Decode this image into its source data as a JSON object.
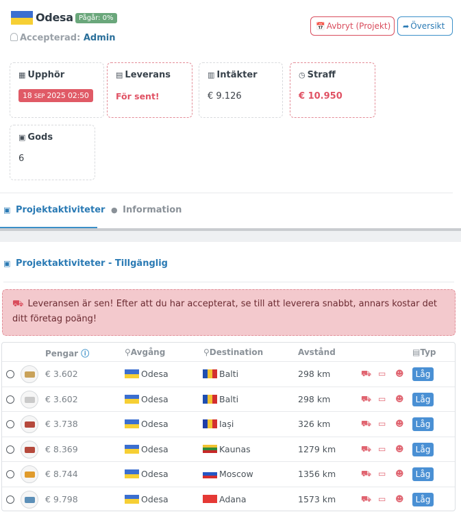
{
  "header": {
    "title": "Odesa",
    "status_badge": "Pågår: 0%",
    "accepted_label": "Accepterad:",
    "accepted_by": "Admin",
    "cancel_button": "Avbryt (Projekt)",
    "overview_button": "Översikt"
  },
  "cards": {
    "end": {
      "label": "Upphör",
      "day": "18",
      "month": "SEP",
      "year_time": "2025 02:50"
    },
    "delivery": {
      "label": "Leverans",
      "value": "För sent!"
    },
    "income": {
      "label": "Intäkter",
      "value": "€ 9.126"
    },
    "penalty": {
      "label": "Straff",
      "value": "€ 10.950"
    },
    "goods": {
      "label": "Gods",
      "value": "6"
    }
  },
  "tabs": [
    {
      "label": "Projektaktiviteter",
      "active": true
    },
    {
      "label": "Information",
      "active": false
    }
  ],
  "section": {
    "title": "Projektaktiviteter - Tillgänglig"
  },
  "alert": {
    "text": "Leveransen är sen! Efter att du har accepterat, se till att leverera snabbt, annars kostar det ditt företag poäng!"
  },
  "table": {
    "headers": {
      "money": "Pengar",
      "departure": "Avgång",
      "destination": "Destination",
      "distance": "Avstånd",
      "type": "Typ"
    },
    "rows": [
      {
        "money": "€ 3.602",
        "from": "Odesa",
        "to": "Balti",
        "distance": "298 km",
        "type": "Låg",
        "goods_color": "#c9a25a",
        "to_flag": [
          "#1f4fb0",
          "#f1c232",
          "#d32f2f"
        ]
      },
      {
        "money": "€ 3.602",
        "from": "Odesa",
        "to": "Balti",
        "distance": "298 km",
        "type": "Låg",
        "goods_color": "#c9c9c9",
        "to_flag": [
          "#1f4fb0",
          "#f1c232",
          "#d32f2f"
        ]
      },
      {
        "money": "€ 3.738",
        "from": "Odesa",
        "to": "Iași",
        "distance": "326 km",
        "type": "Låg",
        "goods_color": "#b5493c",
        "to_flag": [
          "#1f3ea8",
          "#f1c232",
          "#d32f2f"
        ]
      },
      {
        "money": "€ 8.369",
        "from": "Odesa",
        "to": "Kaunas",
        "distance": "1279 km",
        "type": "Låg",
        "goods_color": "#b5493c",
        "to_flag_h": [
          "#f1c232",
          "#2e8b3a",
          "#c62828"
        ]
      },
      {
        "money": "€ 8.744",
        "from": "Odesa",
        "to": "Moscow",
        "distance": "1356 km",
        "type": "Låg",
        "goods_color": "#e09b2c",
        "to_flag_h": [
          "#ffffff",
          "#2457c5",
          "#d32f2f"
        ]
      },
      {
        "money": "€ 9.798",
        "from": "Odesa",
        "to": "Adana",
        "distance": "1573 km",
        "type": "Låg",
        "goods_color": "#5c8fb8",
        "to_flag_h": [
          "#e53935",
          "#e53935",
          "#e53935"
        ]
      }
    ]
  }
}
